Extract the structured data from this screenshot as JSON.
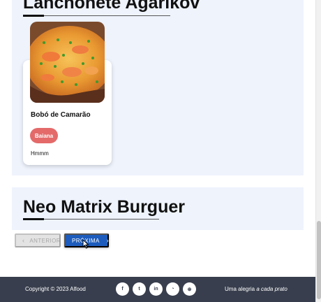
{
  "restaurants": [
    {
      "name": "Lanchonete Agarikov",
      "dishes": [
        {
          "name": "Bobó de Camarão",
          "tag": "Baiana",
          "description": "Hmmm"
        }
      ]
    },
    {
      "name": "Neo Matrix Burguer",
      "dishes": []
    }
  ],
  "pagination": {
    "prev_label": "ANTERIOR",
    "next_label": "PRÓXIMA",
    "prev_enabled": false,
    "next_enabled": true
  },
  "footer": {
    "copyright": "Copyright © 2023 Alfood",
    "social_icons": [
      "facebook-icon",
      "twitter-icon",
      "linkedin-icon",
      "rss-icon",
      "dribbble-icon"
    ],
    "social_glyphs": [
      "f",
      "t",
      "in",
      "◔",
      "⊛"
    ],
    "tagline_plain": "Uma alegria ",
    "tagline_italic": "a cada prato"
  },
  "colors": {
    "section_bg": "#eef3fc",
    "tag_bg": "#e46a6a",
    "primary_button": "#1d5cbc",
    "footer_bg": "#383e4d"
  }
}
